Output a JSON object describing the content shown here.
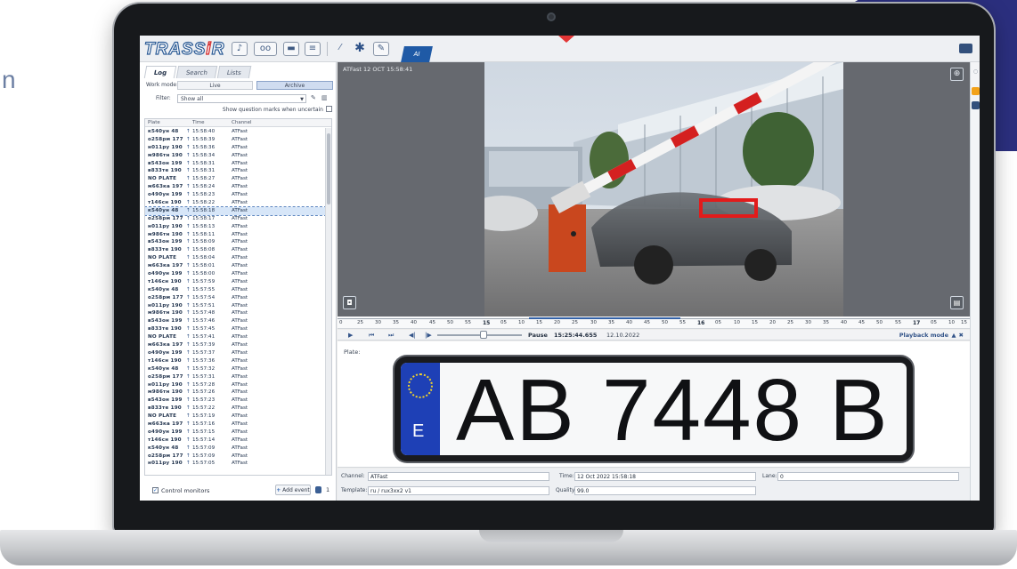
{
  "brand": {
    "left": "TRASS",
    "highlight": "i",
    "right": "R"
  },
  "edge_text": "n",
  "toolbar": {
    "ai_tab_label": "AI",
    "icons": [
      "bell-icon",
      "dots-icon",
      "screen-icon",
      "list-icon",
      "wand-icon",
      "puzzle-icon",
      "edit-icon"
    ]
  },
  "left_panel": {
    "tabs": [
      "Log",
      "Search",
      "Lists"
    ],
    "active_tab": "Log",
    "work_mode_label": "Work mode:",
    "live_label": "Live",
    "archive_label": "Archive",
    "filter_label": "Filter:",
    "filter_value": "Show all",
    "question_marks_label": "Show question marks when uncertain",
    "columns": {
      "plate": "Plate",
      "time": "Time",
      "channel": "Channel"
    },
    "rows": [
      [
        "к540ун 48",
        "15:58:40",
        "ATFast"
      ],
      [
        "о258рм 177",
        "15:58:39",
        "ATFast"
      ],
      [
        "н011ру 190",
        "15:58:36",
        "ATFast"
      ],
      [
        "м986тн 190",
        "15:58:34",
        "ATFast"
      ],
      [
        "в543он 199",
        "15:58:31",
        "ATFast"
      ],
      [
        "в833те 190",
        "15:58:31",
        "ATFast"
      ],
      [
        "NO PLATE",
        "15:58:27",
        "ATFast"
      ],
      [
        "м663ка 197",
        "15:58:24",
        "ATFast"
      ],
      [
        "о490ун 199",
        "15:58:23",
        "ATFast"
      ],
      [
        "т146сн 190",
        "15:58:22",
        "ATFast"
      ],
      [
        "к540ун 48",
        "15:58:18",
        "ATFast"
      ],
      [
        "о258рм 177",
        "15:58:17",
        "ATFast"
      ],
      [
        "н011ру 190",
        "15:58:13",
        "ATFast"
      ],
      [
        "м986тн 190",
        "15:58:11",
        "ATFast"
      ],
      [
        "в543он 199",
        "15:58:09",
        "ATFast"
      ],
      [
        "в833те 190",
        "15:58:08",
        "ATFast"
      ],
      [
        "NO PLATE",
        "15:58:04",
        "ATFast"
      ],
      [
        "м663ка 197",
        "15:58:01",
        "ATFast"
      ],
      [
        "о490ун 199",
        "15:58:00",
        "ATFast"
      ],
      [
        "т146сн 190",
        "15:57:59",
        "ATFast"
      ],
      [
        "к540ун 48",
        "15:57:55",
        "ATFast"
      ],
      [
        "о258рм 177",
        "15:57:54",
        "ATFast"
      ],
      [
        "н011ру 190",
        "15:57:51",
        "ATFast"
      ],
      [
        "м986тн 190",
        "15:57:48",
        "ATFast"
      ],
      [
        "в543он 199",
        "15:57:46",
        "ATFast"
      ],
      [
        "в833те 190",
        "15:57:45",
        "ATFast"
      ],
      [
        "NO PLATE",
        "15:57:41",
        "ATFast"
      ],
      [
        "м663ка 197",
        "15:57:39",
        "ATFast"
      ],
      [
        "о490ун 199",
        "15:57:37",
        "ATFast"
      ],
      [
        "т146сн 190",
        "15:57:36",
        "ATFast"
      ],
      [
        "к540ун 48",
        "15:57:32",
        "ATFast"
      ],
      [
        "о258рм 177",
        "15:57:31",
        "ATFast"
      ],
      [
        "н011ру 190",
        "15:57:28",
        "ATFast"
      ],
      [
        "м986тн 190",
        "15:57:26",
        "ATFast"
      ],
      [
        "в543он 199",
        "15:57:23",
        "ATFast"
      ],
      [
        "в833те 190",
        "15:57:22",
        "ATFast"
      ],
      [
        "NO PLATE",
        "15:57:19",
        "ATFast"
      ],
      [
        "м663ка 197",
        "15:57:16",
        "ATFast"
      ],
      [
        "о490ун 199",
        "15:57:15",
        "ATFast"
      ],
      [
        "т146сн 190",
        "15:57:14",
        "ATFast"
      ],
      [
        "к540ун 48",
        "15:57:09",
        "ATFast"
      ],
      [
        "о258рм 177",
        "15:57:09",
        "ATFast"
      ],
      [
        "н011ру 190",
        "15:57:05",
        "ATFast"
      ]
    ],
    "selected_row": 10,
    "control_monitors_label": "Control monitors",
    "add_event_label": "Add event",
    "event_count": "1"
  },
  "video": {
    "channel_overlay": "ATFast 12 OCT 15:58:41"
  },
  "timeline": {
    "labels": [
      "0",
      "25",
      "30",
      "35",
      "40",
      "45",
      "50",
      "55",
      "15",
      "05",
      "10",
      "15",
      "20",
      "25",
      "30",
      "35",
      "40",
      "45",
      "50",
      "55",
      "16",
      "05",
      "10",
      "15",
      "20",
      "25",
      "30",
      "35",
      "40",
      "45",
      "50",
      "55",
      "17",
      "05",
      "10",
      "15"
    ],
    "bold_labels": [
      "15",
      "16",
      "17"
    ]
  },
  "playback": {
    "state": "Pause",
    "time": "15:25:44.655",
    "date": "12.10.2022",
    "mode_label": "Playback mode"
  },
  "plate_view": {
    "label": "Plate:",
    "plate_number": "AB 7448 B",
    "country_code": "E"
  },
  "info": {
    "channel_label": "Channel:",
    "channel_value": "ATFast",
    "time_label": "Time:",
    "time_value": "12 Oct 2022 15:58:18",
    "lane_label": "Lane:",
    "lane_value": "0",
    "template_label": "Template:",
    "template_value": "ru / rux3xx2 v1",
    "quality_label": "Quality:",
    "quality_value": "99.0"
  },
  "colors": {
    "accent": "#1f5aa6",
    "detection_box": "#e21b1b",
    "corner": "#2b2f7e",
    "plate_blue": "#1e40b6"
  }
}
